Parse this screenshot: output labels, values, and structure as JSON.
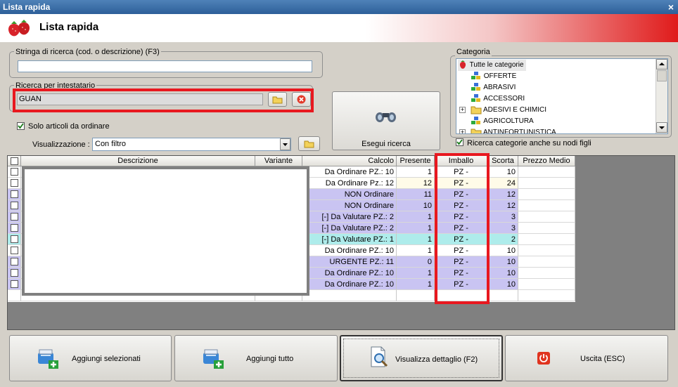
{
  "window": {
    "title": "Lista rapida",
    "header_title": "Lista rapida",
    "close_glyph": "×"
  },
  "search": {
    "label": "Stringa di ricerca (cod. o descrizione) (F3)",
    "value": ""
  },
  "holder": {
    "label": "Ricerca per intestatario",
    "value": "GUAN"
  },
  "only_to_order": {
    "label": "Solo articoli da ordinare",
    "checked": true
  },
  "view": {
    "label": "Visualizzazione :",
    "selected": "Con filtro"
  },
  "search_button": {
    "label": "Esegui ricerca"
  },
  "category": {
    "label": "Categoria",
    "items": [
      {
        "label": "Tutte le categorie",
        "icon": "strawberry-icon"
      },
      {
        "label": "OFFERTE",
        "icon": "cubes-icon"
      },
      {
        "label": "ABRASIVI",
        "icon": "cubes-icon"
      },
      {
        "label": "ACCESSORI",
        "icon": "cubes-icon"
      },
      {
        "label": "ADESIVI E CHIMICI",
        "icon": "folder-icon",
        "expander": "+"
      },
      {
        "label": "AGRICOLTURA",
        "icon": "cubes-icon"
      },
      {
        "label": "ANTINFORTUNISTICA",
        "icon": "folder-icon",
        "expander": "+"
      }
    ],
    "subnodes_label": "Ricerca categorie anche su nodi figli",
    "subnodes_checked": true
  },
  "grid": {
    "columns": [
      "",
      "Descrizione",
      "Variante",
      "Calcolo",
      "Presente",
      "Imballo",
      "Scorta",
      "Prezzo Medio"
    ],
    "rows": [
      {
        "calcolo": "Da Ordinare PZ.: 10",
        "presente": "1",
        "imballo": "PZ -",
        "scorta": "10",
        "bg": "#ffffff"
      },
      {
        "calcolo": "Da Ordinare Pz.: 12",
        "presente": "12",
        "imballo": "PZ -",
        "scorta": "24",
        "bg": "#ffffff"
      },
      {
        "calcolo": "NON Ordinare",
        "presente": "11",
        "imballo": "PZ -",
        "scorta": "12",
        "bg": "#c9c4f2"
      },
      {
        "calcolo": "NON Ordinare",
        "presente": "10",
        "imballo": "PZ -",
        "scorta": "12",
        "bg": "#c9c4f2"
      },
      {
        "calcolo": "[-] Da Valutare PZ.: 2",
        "presente": "1",
        "imballo": "PZ -",
        "scorta": "3",
        "bg": "#c9c4f2"
      },
      {
        "calcolo": "[-] Da Valutare PZ.: 2",
        "presente": "1",
        "imballo": "PZ -",
        "scorta": "3",
        "bg": "#c9c4f2"
      },
      {
        "calcolo": "[-] Da Valutare PZ.: 1",
        "presente": "1",
        "imballo": "PZ -",
        "scorta": "2",
        "bg": "#aeeceb"
      },
      {
        "calcolo": "Da Ordinare PZ.: 10",
        "presente": "1",
        "imballo": "PZ -",
        "scorta": "10",
        "bg": "#ffffff"
      },
      {
        "calcolo": "URGENTE PZ.: 11",
        "presente": "0",
        "imballo": "PZ -",
        "scorta": "10",
        "bg": "#c9c4f2"
      },
      {
        "calcolo": "Da Ordinare PZ.: 10",
        "presente": "1",
        "imballo": "PZ -",
        "scorta": "10",
        "bg": "#c9c4f2"
      },
      {
        "calcolo": "Da Ordinare PZ.: 10",
        "presente": "1",
        "imballo": "PZ -",
        "scorta": "10",
        "bg": "#c9c4f2"
      }
    ]
  },
  "buttons": {
    "add_selected": "Aggiungi selezionati",
    "add_all": "Aggiungi tutto",
    "detail": "Visualizza dettaglio (F2)",
    "exit": "Uscita (ESC)"
  },
  "colors": {
    "accent_red": "#e8181f",
    "title_blue": "#2d5f99"
  }
}
